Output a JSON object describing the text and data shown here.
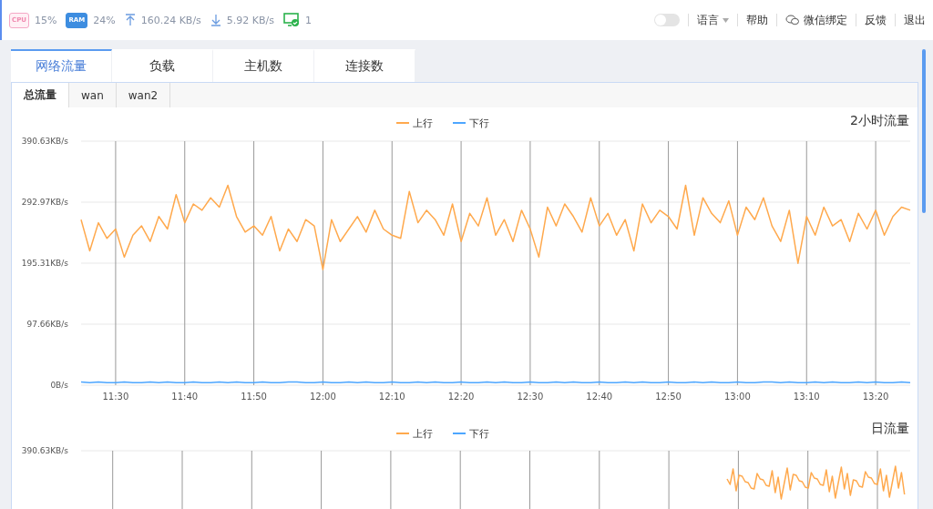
{
  "status_bar": {
    "cpu": {
      "icon_label": "CPU",
      "value": "15%"
    },
    "ram": {
      "icon_label": "RAM",
      "value": "24%"
    },
    "upload": "160.24 KB/s",
    "download": "5.92 KB/s",
    "devices": "1"
  },
  "top_nav": {
    "toggle": {
      "on": false
    },
    "items": [
      {
        "kind": "dropdown",
        "label": "语言"
      },
      {
        "kind": "link",
        "label": "帮助"
      },
      {
        "kind": "wechat",
        "label": "微信绑定"
      },
      {
        "kind": "link",
        "label": "反馈"
      },
      {
        "kind": "link",
        "label": "退出"
      }
    ]
  },
  "tabs": [
    {
      "label": "网络流量",
      "selected": true
    },
    {
      "label": "负载",
      "selected": false
    },
    {
      "label": "主机数",
      "selected": false
    },
    {
      "label": "连接数",
      "selected": false
    }
  ],
  "sub_tabs": [
    {
      "label": "总流量",
      "selected": true
    },
    {
      "label": "wan",
      "selected": false
    },
    {
      "label": "wan2",
      "selected": false
    }
  ],
  "hourly_chart": {
    "chart_data": {
      "type": "line",
      "title": "2小时流量",
      "categories": [
        null,
        null,
        null,
        null,
        "11:30",
        null,
        null,
        null,
        null,
        null,
        null,
        null,
        "11:40",
        null,
        null,
        null,
        null,
        null,
        null,
        null,
        "11:50",
        null,
        null,
        null,
        null,
        null,
        null,
        null,
        "12:00",
        null,
        null,
        null,
        null,
        null,
        null,
        null,
        "12:10",
        null,
        null,
        null,
        null,
        null,
        null,
        null,
        "12:20",
        null,
        null,
        null,
        null,
        null,
        null,
        null,
        "12:30",
        null,
        null,
        null,
        null,
        null,
        null,
        null,
        "12:40",
        null,
        null,
        null,
        null,
        null,
        null,
        null,
        "12:50",
        null,
        null,
        null,
        null,
        null,
        null,
        null,
        "13:00",
        null,
        null,
        null,
        null,
        null,
        null,
        null,
        "13:10",
        null,
        null,
        null,
        null,
        null,
        null,
        null,
        "13:20",
        null,
        null,
        null,
        null
      ],
      "series": [
        {
          "name": "上行",
          "color": "#ffa94d",
          "values": [
            265,
            215,
            260,
            235,
            250,
            205,
            240,
            255,
            230,
            270,
            250,
            305,
            260,
            290,
            280,
            300,
            285,
            320,
            270,
            245,
            255,
            240,
            270,
            215,
            250,
            230,
            265,
            255,
            185,
            265,
            230,
            250,
            270,
            245,
            280,
            250,
            240,
            235,
            310,
            260,
            280,
            265,
            240,
            290,
            230,
            275,
            255,
            300,
            240,
            265,
            230,
            280,
            250,
            205,
            285,
            255,
            290,
            270,
            245,
            300,
            255,
            275,
            240,
            265,
            215,
            290,
            260,
            280,
            270,
            250,
            320,
            240,
            300,
            275,
            260,
            295,
            240,
            285,
            265,
            300,
            255,
            230,
            280,
            195,
            270,
            240,
            285,
            255,
            265,
            230,
            275,
            250,
            280,
            240,
            270,
            285,
            280
          ]
        },
        {
          "name": "下行",
          "color": "#4da6ff",
          "values": [
            5,
            4,
            5,
            4,
            4,
            5,
            4,
            4,
            5,
            4,
            5,
            4,
            4,
            5,
            4,
            4,
            5,
            4,
            5,
            4,
            4,
            5,
            4,
            4,
            5,
            5,
            4,
            4,
            5,
            4,
            4,
            5,
            4,
            5,
            4,
            4,
            5,
            4,
            4,
            5,
            4,
            5,
            4,
            4,
            5,
            4,
            4,
            5,
            4,
            5,
            4,
            4,
            5,
            4,
            4,
            5,
            4,
            5,
            4,
            4,
            5,
            4,
            4,
            5,
            4,
            5,
            4,
            4,
            5,
            4,
            4,
            5,
            4,
            5,
            4,
            4,
            5,
            4,
            4,
            5,
            5,
            4,
            5,
            4,
            4,
            5,
            4,
            5,
            4,
            4,
            5,
            4,
            5,
            4,
            4,
            5,
            4
          ]
        }
      ],
      "grid": true,
      "legend": "top",
      "ylim": [
        0,
        390.63
      ],
      "yticks": [
        {
          "value": 0,
          "label": "0B/s"
        },
        {
          "value": 97.66,
          "label": "97.66KB/s"
        },
        {
          "value": 195.31,
          "label": "195.31KB/s"
        },
        {
          "value": 292.97,
          "label": "292.97KB/s"
        },
        {
          "value": 390.63,
          "label": "390.63KB/s"
        }
      ]
    }
  },
  "daily_chart": {
    "title": "日流量",
    "legend": [
      {
        "name": "上行",
        "color": "#ffa94d"
      },
      {
        "name": "下行",
        "color": "#4da6ff"
      }
    ],
    "top_tick": "390.63KB/s"
  }
}
